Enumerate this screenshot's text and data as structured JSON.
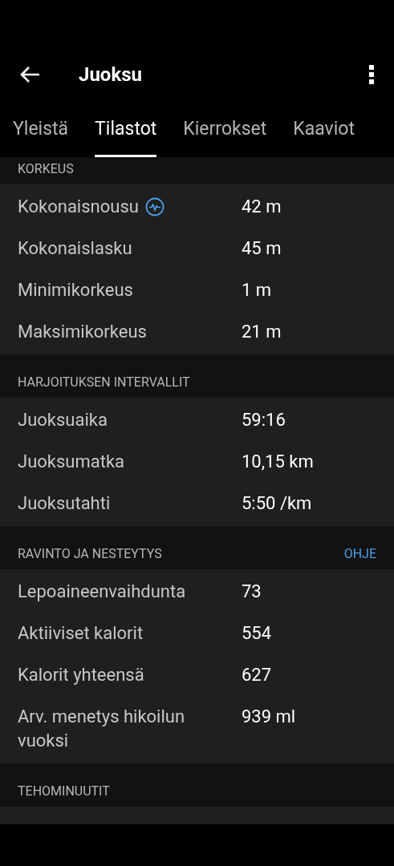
{
  "app_bar": {
    "title": "Juoksu"
  },
  "tabs": [
    {
      "label": "Yleistä",
      "selected": false
    },
    {
      "label": "Tilastot",
      "selected": true
    },
    {
      "label": "Kierrokset",
      "selected": false
    },
    {
      "label": "Kaaviot",
      "selected": false
    }
  ],
  "sections": [
    {
      "title": "KORKEUS",
      "rows": [
        {
          "label": "Kokonaisnousu",
          "value": "42 m",
          "has_info_icon": true
        },
        {
          "label": "Kokonaislasku",
          "value": "45 m"
        },
        {
          "label": "Minimikorkeus",
          "value": "1 m"
        },
        {
          "label": "Maksimikorkeus",
          "value": "21 m"
        }
      ]
    },
    {
      "title": "HARJOITUKSEN INTERVALLIT",
      "rows": [
        {
          "label": "Juoksuaika",
          "value": "59:16"
        },
        {
          "label": "Juoksumatka",
          "value": "10,15 km"
        },
        {
          "label": "Juoksutahti",
          "value": "5:50 /km"
        }
      ]
    },
    {
      "title": "RAVINTO JA NESTEYTYS",
      "link": "OHJE",
      "rows": [
        {
          "label": "Lepoaineenvaihdunta",
          "value": "73"
        },
        {
          "label": "Aktiiviset kalorit",
          "value": "554"
        },
        {
          "label": "Kalorit yhteensä",
          "value": "627"
        },
        {
          "label": "Arv. menetys hikoilun vuoksi",
          "value": "939 ml"
        }
      ]
    },
    {
      "title": "TEHOMINUUTIT",
      "cut_row": true
    }
  ]
}
